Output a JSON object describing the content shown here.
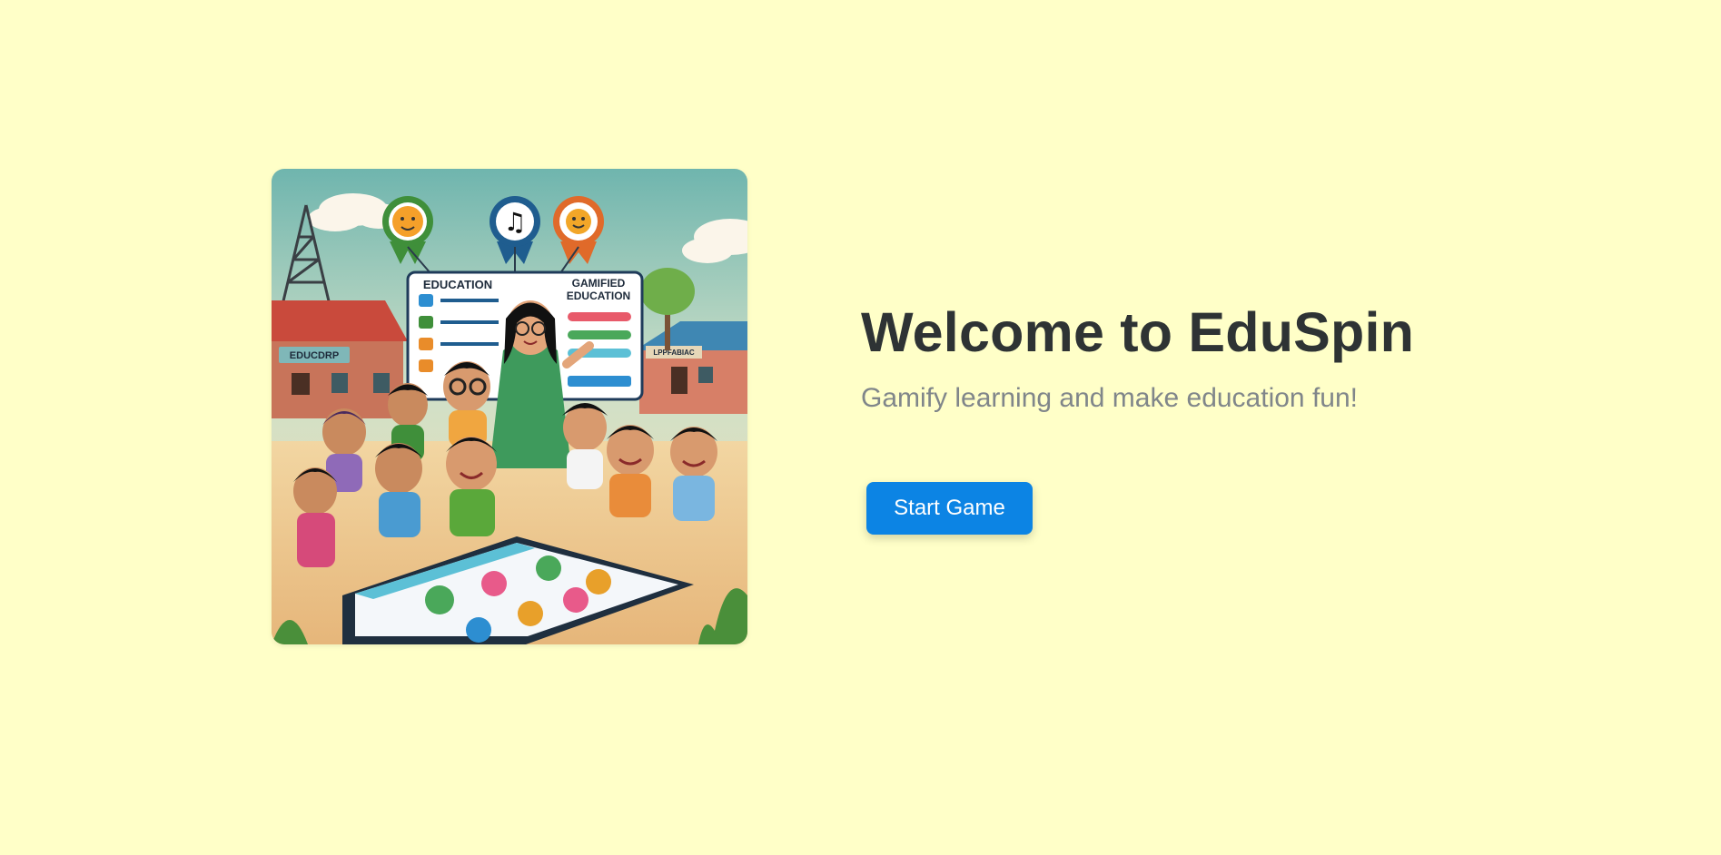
{
  "hero": {
    "title": "Welcome to EduSpin",
    "subtitle": "Gamify learning and make education fun!",
    "start_button_label": "Start Game"
  },
  "illustration": {
    "board_left_label": "EDUCATION",
    "board_right_label_line1": "GAMIFIED",
    "board_right_label_line2": "EDUCATION",
    "school_sign_label": "EDUCDRP",
    "right_house_sign_label": "LPPFABIAC"
  },
  "colors": {
    "background": "#ffffc8",
    "title": "#2e3334",
    "subtitle": "#80868a",
    "button": "#0c84e4",
    "button_text": "#ffffff"
  }
}
